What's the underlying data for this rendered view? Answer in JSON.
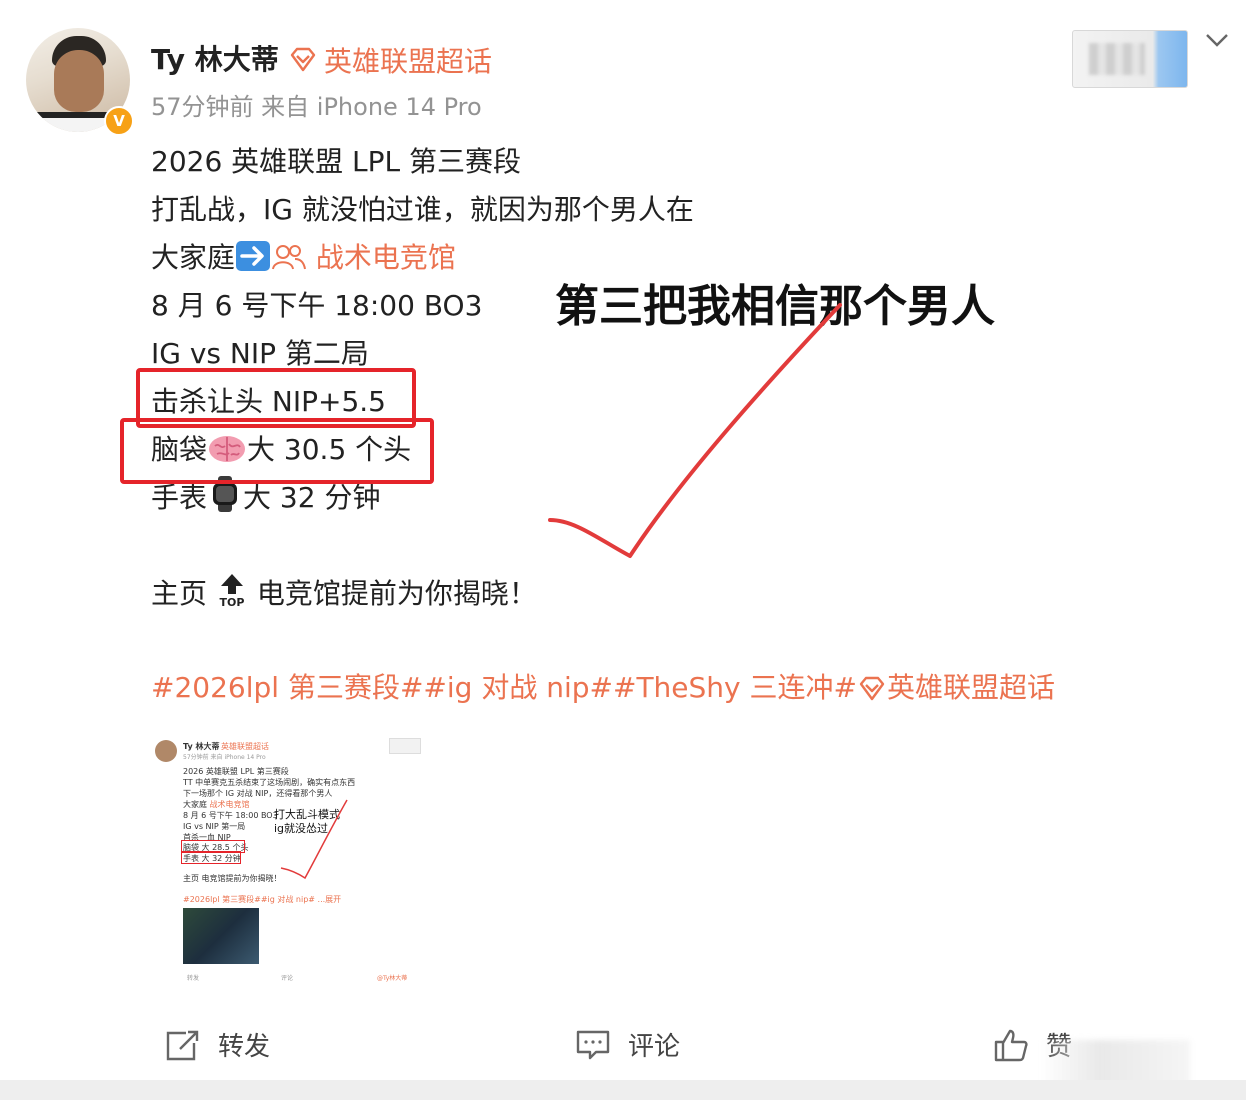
{
  "post": {
    "username": "Ty 林大蒂",
    "topic": "英雄联盟超话",
    "meta": "57分钟前  来自 iPhone 14 Pro",
    "verified_badge": "V",
    "lines": {
      "l1": "2026 英雄联盟 LPL 第三赛段",
      "l2": "打乱战，IG 就没怕过谁，就因为那个男人在",
      "l3a": "大家庭",
      "l3b": "战术电竞馆",
      "l4": "8 月 6 号下午 18:00 BO3",
      "l5": "IG vs NIP 第二局",
      "l6": "击杀让头 NIP+5.5",
      "l7a": "脑袋",
      "l7b": "大 30.5 个头",
      "l8a": "手表",
      "l8b": "大 32 分钟",
      "l9a": "主页",
      "l9b": "电竞馆提前为你揭晓！"
    },
    "hashtags": "#2026lpl 第三赛段##ig 对战 nip##TheShy 三连冲#",
    "hashtag_topic": "英雄联盟超话",
    "annotation": "第三把我相信那个男人"
  },
  "thumbnail": {
    "name": "Ty 林大蒂",
    "topic": "英雄联盟超话",
    "meta": "57分钟前 来自 iPhone 14 Pro",
    "l1": "2026 英雄联盟 LPL 第三赛段",
    "l2": "TT 中单赛克五杀结束了这场闹剧，确实有点东西",
    "l3": "下一场那个 IG 对战 NIP，还得看那个男人",
    "l4a": "大家庭",
    "l4b": "战术电竞馆",
    "l5": "8 月 6 号下午 18:00 BO3",
    "l6": "IG vs NIP 第一局",
    "l7": "首杀一血 NIP",
    "l8": "脑袋    大 28.5 个头",
    "l9": "手表    大 32 分钟",
    "l10": "主页    电竞馆提前为你揭晓！",
    "l11": "#2026lpl 第三赛段##ig 对战 nip# ...展开",
    "anno1": "打大乱斗模式",
    "anno2": "ig就没怂过",
    "repost": "转发",
    "comment": "评论",
    "watermark": "@Ty林大蒂"
  },
  "actions": {
    "repost": "转发",
    "comment": "评论",
    "like": "赞"
  },
  "colors": {
    "accent_orange": "#eb7350",
    "highlight_red": "#e5242a",
    "meta_gray": "#939393"
  },
  "icons": [
    "diamond-icon",
    "verified-icon",
    "chevron-down-icon",
    "right-arrow-emoji",
    "people-icon",
    "brain-emoji",
    "watch-emoji",
    "top-arrow-emoji",
    "repost-icon",
    "comment-icon",
    "like-icon"
  ]
}
